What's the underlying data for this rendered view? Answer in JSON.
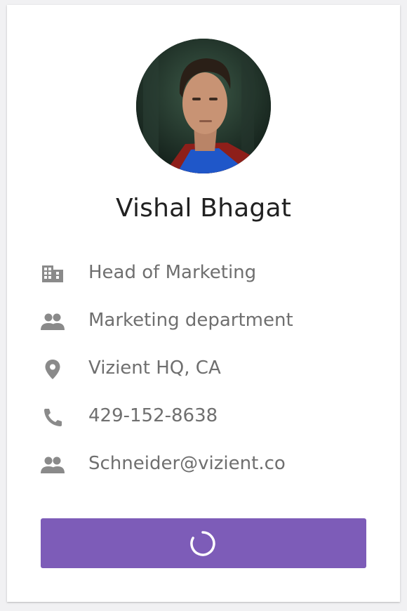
{
  "profile": {
    "name": "Vishal Bhagat",
    "avatar_icon": "profile-photo"
  },
  "details": [
    {
      "icon": "building-icon",
      "text": "Head of Marketing"
    },
    {
      "icon": "people-icon",
      "text": "Marketing department"
    },
    {
      "icon": "location-pin-icon",
      "text": "Vizient HQ, CA"
    },
    {
      "icon": "phone-icon",
      "text": "429-152-8638"
    },
    {
      "icon": "people-icon",
      "text": "Schneider@vizient.co"
    }
  ],
  "action_button": {
    "state": "loading",
    "icon": "spinner-icon",
    "color": "#7d5cb8"
  },
  "colors": {
    "icon": "#8a8a8a",
    "text": "#6f6f6f",
    "name": "#212121"
  }
}
